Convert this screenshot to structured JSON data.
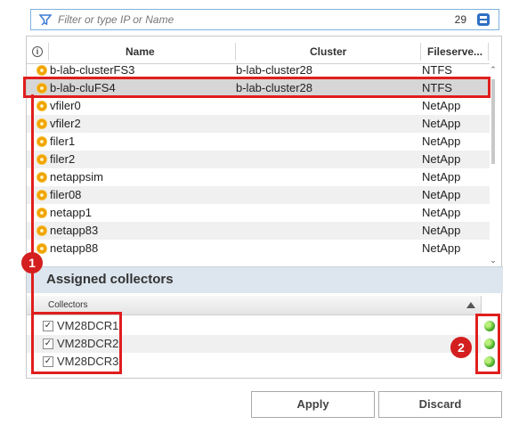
{
  "filter": {
    "placeholder": "Filter or type IP or Name",
    "count": "29"
  },
  "grid": {
    "columns": {
      "name": "Name",
      "cluster": "Cluster",
      "fileserver": "Fileserve..."
    },
    "rows": [
      {
        "name": "b-lab-clusterFS3",
        "cluster": "b-lab-cluster28",
        "fs": "NTFS"
      },
      {
        "name": "b-lab-cluFS4",
        "cluster": "b-lab-cluster28",
        "fs": "NTFS"
      },
      {
        "name": "vfiler0",
        "cluster": "",
        "fs": "NetApp"
      },
      {
        "name": "vfiler2",
        "cluster": "",
        "fs": "NetApp"
      },
      {
        "name": "filer1",
        "cluster": "",
        "fs": "NetApp"
      },
      {
        "name": "filer2",
        "cluster": "",
        "fs": "NetApp"
      },
      {
        "name": "netappsim",
        "cluster": "",
        "fs": "NetApp"
      },
      {
        "name": "filer08",
        "cluster": "",
        "fs": "NetApp"
      },
      {
        "name": "netapp1",
        "cluster": "",
        "fs": "NetApp"
      },
      {
        "name": "netapp83",
        "cluster": "",
        "fs": "NetApp"
      },
      {
        "name": "netapp88",
        "cluster": "",
        "fs": "NetApp"
      }
    ]
  },
  "assigned": {
    "title": "Assigned collectors",
    "column": "Collectors",
    "items": [
      {
        "name": "VM28DCR1",
        "checked": true,
        "status": "online"
      },
      {
        "name": "VM28DCR2",
        "checked": true,
        "status": "online"
      },
      {
        "name": "VM28DCR3",
        "checked": true,
        "status": "online"
      }
    ]
  },
  "annotations": {
    "badge1": "1",
    "badge2": "2"
  },
  "buttons": {
    "apply": "Apply",
    "discard": "Discard"
  },
  "colors": {
    "highlight": "#e01e1e",
    "section_bg": "#dde6ee",
    "status_green": "#4caf2a"
  }
}
